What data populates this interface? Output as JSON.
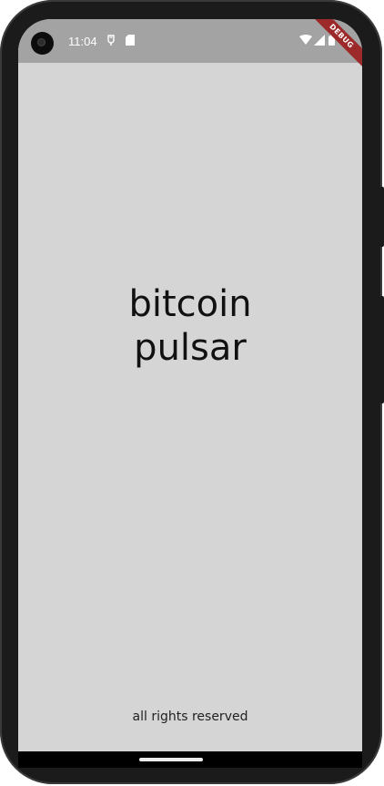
{
  "status_bar": {
    "time": "11:04",
    "left_icons": [
      "usb-icon",
      "sd-card-icon"
    ],
    "right_icons": [
      "wifi-icon",
      "cellular-signal-icon",
      "battery-icon"
    ]
  },
  "debug_banner": {
    "label": "DEBUG",
    "color": "#9c2a2a"
  },
  "app": {
    "title_line1": "bitcoin",
    "title_line2": "pulsar",
    "footer": "all rights reserved",
    "background_color": "#d6d5d5"
  }
}
